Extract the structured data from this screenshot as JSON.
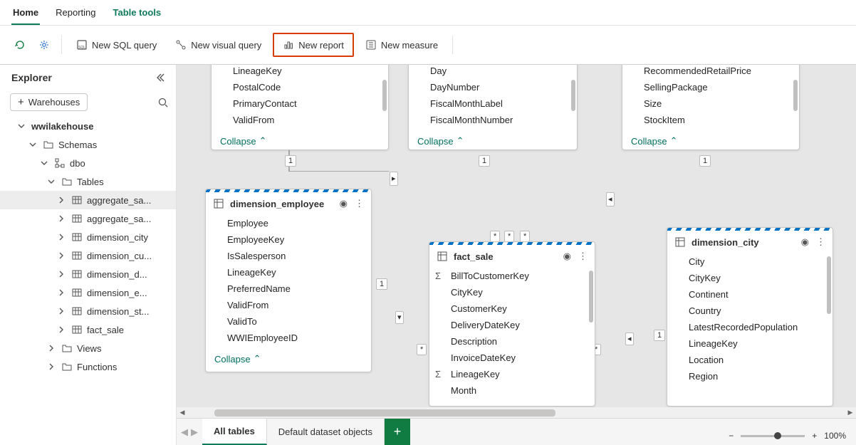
{
  "ribbon": {
    "tabs": [
      "Home",
      "Reporting",
      "Table tools"
    ],
    "active": "Home"
  },
  "toolbar": {
    "refresh": "",
    "settings": "",
    "new_sql": "New SQL query",
    "new_visual": "New visual query",
    "new_report": "New report",
    "new_measure": "New measure"
  },
  "explorer": {
    "title": "Explorer",
    "warehouses_btn": "Warehouses",
    "search_placeholder": "",
    "tree": {
      "lakehouse": "wwilakehouse",
      "schemas": "Schemas",
      "dbo": "dbo",
      "tables": "Tables",
      "table_items": [
        "aggregate_sa...",
        "aggregate_sa...",
        "dimension_city",
        "dimension_cu...",
        "dimension_d...",
        "dimension_e...",
        "dimension_st...",
        "fact_sale"
      ],
      "views": "Views",
      "functions": "Functions"
    }
  },
  "cards": {
    "partial1": {
      "cols": [
        "LineageKey",
        "PostalCode",
        "PrimaryContact",
        "ValidFrom"
      ],
      "collapse": "Collapse"
    },
    "partial2": {
      "cols": [
        "Day",
        "DayNumber",
        "FiscalMonthLabel",
        "FiscalMonthNumber"
      ],
      "collapse": "Collapse"
    },
    "partial3": {
      "cols": [
        "RecommendedRetailPrice",
        "SellingPackage",
        "Size",
        "StockItem"
      ],
      "collapse": "Collapse"
    },
    "employee": {
      "title": "dimension_employee",
      "cols": [
        "Employee",
        "EmployeeKey",
        "IsSalesperson",
        "LineageKey",
        "PreferredName",
        "ValidFrom",
        "ValidTo",
        "WWIEmployeeID"
      ],
      "collapse": "Collapse"
    },
    "fact": {
      "title": "fact_sale",
      "cols": [
        "BillToCustomerKey",
        "CityKey",
        "CustomerKey",
        "DeliveryDateKey",
        "Description",
        "InvoiceDateKey",
        "LineageKey",
        "Month"
      ]
    },
    "city": {
      "title": "dimension_city",
      "cols": [
        "City",
        "CityKey",
        "Continent",
        "Country",
        "LatestRecordedPopulation",
        "LineageKey",
        "Location",
        "Region"
      ]
    }
  },
  "bottom": {
    "tab_all": "All tables",
    "tab_default": "Default dataset objects"
  },
  "zoom": {
    "minus": "−",
    "plus": "+",
    "value": "100%"
  }
}
